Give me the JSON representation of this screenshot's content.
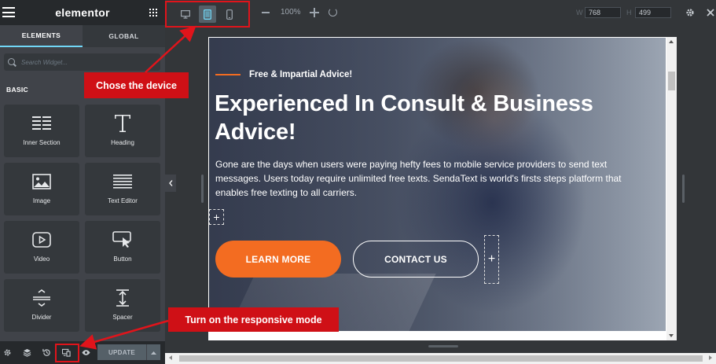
{
  "app": {
    "brand": "elementor",
    "tabs": [
      {
        "label": "ELEMENTS",
        "active": true
      },
      {
        "label": "GLOBAL",
        "active": false
      }
    ],
    "search": {
      "placeholder": "Search Widget..."
    },
    "section_title": "BASIC",
    "widgets": [
      {
        "label": "Inner Section",
        "icon": "inner-section-icon"
      },
      {
        "label": "Heading",
        "icon": "heading-icon"
      },
      {
        "label": "Image",
        "icon": "image-icon"
      },
      {
        "label": "Text Editor",
        "icon": "text-editor-icon"
      },
      {
        "label": "Video",
        "icon": "video-icon"
      },
      {
        "label": "Button",
        "icon": "button-icon"
      },
      {
        "label": "Divider",
        "icon": "divider-icon"
      },
      {
        "label": "Spacer",
        "icon": "spacer-icon"
      }
    ],
    "footer": {
      "update_label": "UPDATE"
    }
  },
  "topbar": {
    "devices": [
      "desktop",
      "tablet",
      "mobile"
    ],
    "active_device": "tablet",
    "zoom": "100%",
    "width_label": "W",
    "width_value": "768",
    "height_label": "H",
    "height_value": "499"
  },
  "preview": {
    "eyebrow": "Free & Impartial Advice!",
    "headline": "Experienced In Consult & Business Advice!",
    "paragraph": "Gone are the days when users were paying hefty fees to mobile service providers to send text messages. Users today require unlimited free texts. SendaText is world's firsts steps platform that enables free texting to all carriers.",
    "learn_more": "LEARN MORE",
    "contact_us": "CONTACT US",
    "add_symbol": "+"
  },
  "annotations": {
    "device_callout": "Chose the device",
    "responsive_callout": "Turn on the responsive mode"
  },
  "colors": {
    "panel_bg": "#404349",
    "header_bg": "#26292c",
    "accent_tab": "#71d7f7",
    "orange": "#f36c21",
    "annotation_red": "#cf1016"
  }
}
